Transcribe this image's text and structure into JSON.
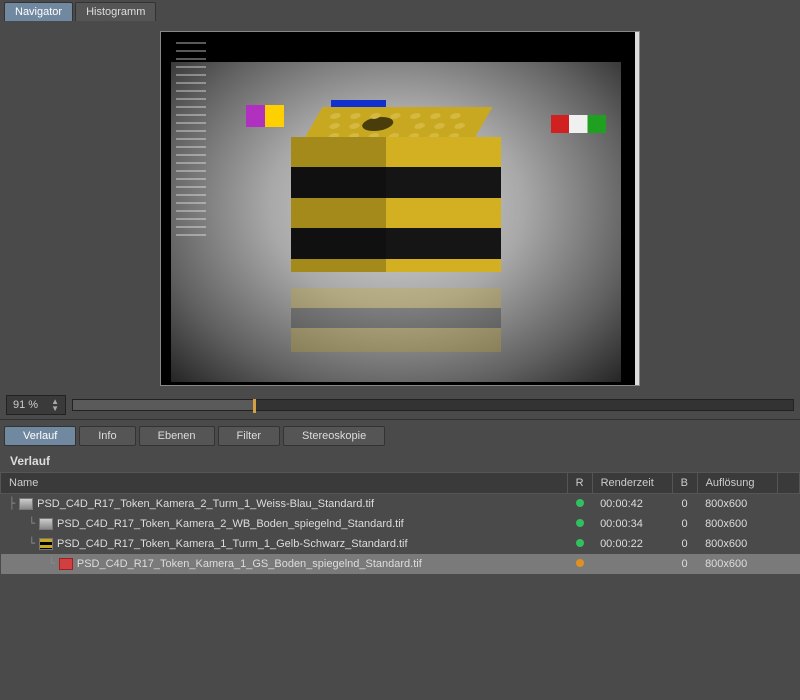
{
  "top_tabs": {
    "navigator": "Navigator",
    "histogram": "Histogramm"
  },
  "zoom": {
    "value": "91 %"
  },
  "mid_tabs": {
    "verlauf": "Verlauf",
    "info": "Info",
    "ebenen": "Ebenen",
    "filter": "Filter",
    "stereoskopie": "Stereoskopie"
  },
  "section_title": "Verlauf",
  "table": {
    "headers": {
      "name": "Name",
      "r": "R",
      "renderzeit": "Renderzeit",
      "b": "B",
      "aufloesung": "Auflösung"
    },
    "rows": [
      {
        "indent": 1,
        "icon": "gray",
        "name": "PSD_C4D_R17_Token_Kamera_2_Turm_1_Weiss-Blau_Standard.tif",
        "status": "green",
        "renderzeit": "00:00:42",
        "b": "0",
        "res": "800x600",
        "selected": false
      },
      {
        "indent": 2,
        "icon": "gray",
        "name": "PSD_C4D_R17_Token_Kamera_2_WB_Boden_spiegelnd_Standard.tif",
        "status": "green",
        "renderzeit": "00:00:34",
        "b": "0",
        "res": "800x600",
        "selected": false
      },
      {
        "indent": 2,
        "icon": "yb",
        "name": "PSD_C4D_R17_Token_Kamera_1_Turm_1_Gelb-Schwarz_Standard.tif",
        "status": "green",
        "renderzeit": "00:00:22",
        "b": "0",
        "res": "800x600",
        "selected": false
      },
      {
        "indent": 3,
        "icon": "red",
        "name": "PSD_C4D_R17_Token_Kamera_1_GS_Boden_spiegelnd_Standard.tif",
        "status": "orange",
        "renderzeit": "",
        "b": "0",
        "res": "800x600",
        "selected": true
      }
    ]
  }
}
